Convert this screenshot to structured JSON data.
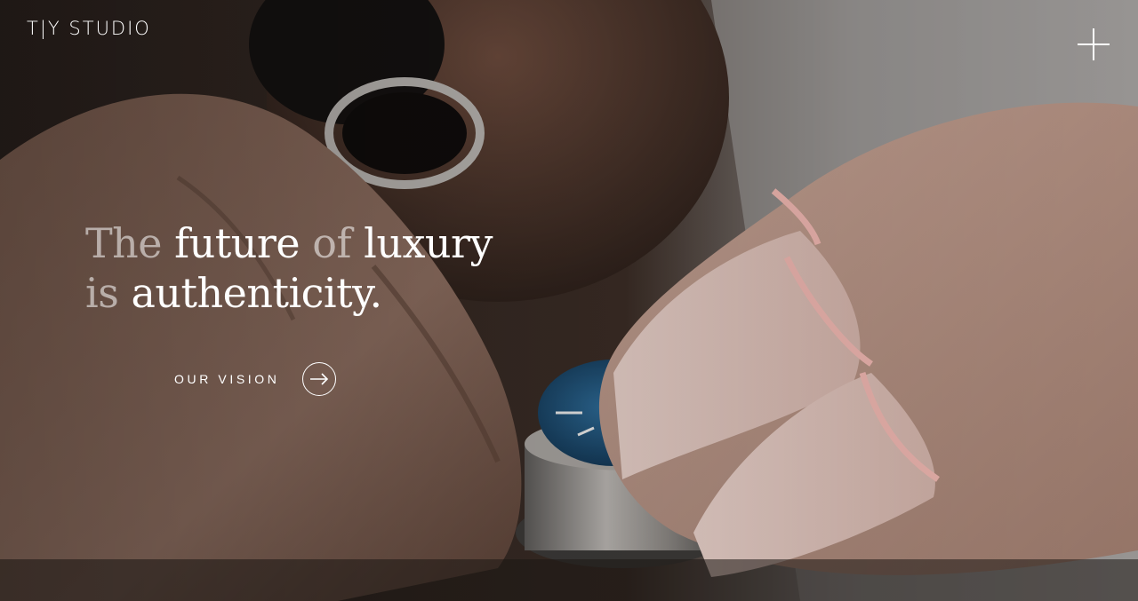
{
  "header": {
    "logo_text": "T|Y STUDIO",
    "menu_icon": "plus-icon"
  },
  "hero": {
    "headline": {
      "line1": [
        {
          "text": "The",
          "tone": "muted"
        },
        {
          "text": "future",
          "tone": "strong"
        },
        {
          "text": "of",
          "tone": "muted"
        },
        {
          "text": "luxury",
          "tone": "strong"
        }
      ],
      "line2": [
        {
          "text": "is",
          "tone": "muted"
        },
        {
          "text": "authenticity.",
          "tone": "strong"
        }
      ]
    },
    "cta": {
      "label": "OUR VISION",
      "icon": "arrow-right-icon"
    }
  },
  "colors": {
    "text": "#ffffff",
    "muted_text": "rgba(255,255,255,0.55)",
    "accent_dial": "#1f4a6e",
    "finger_cot": "#e9c9c1"
  }
}
